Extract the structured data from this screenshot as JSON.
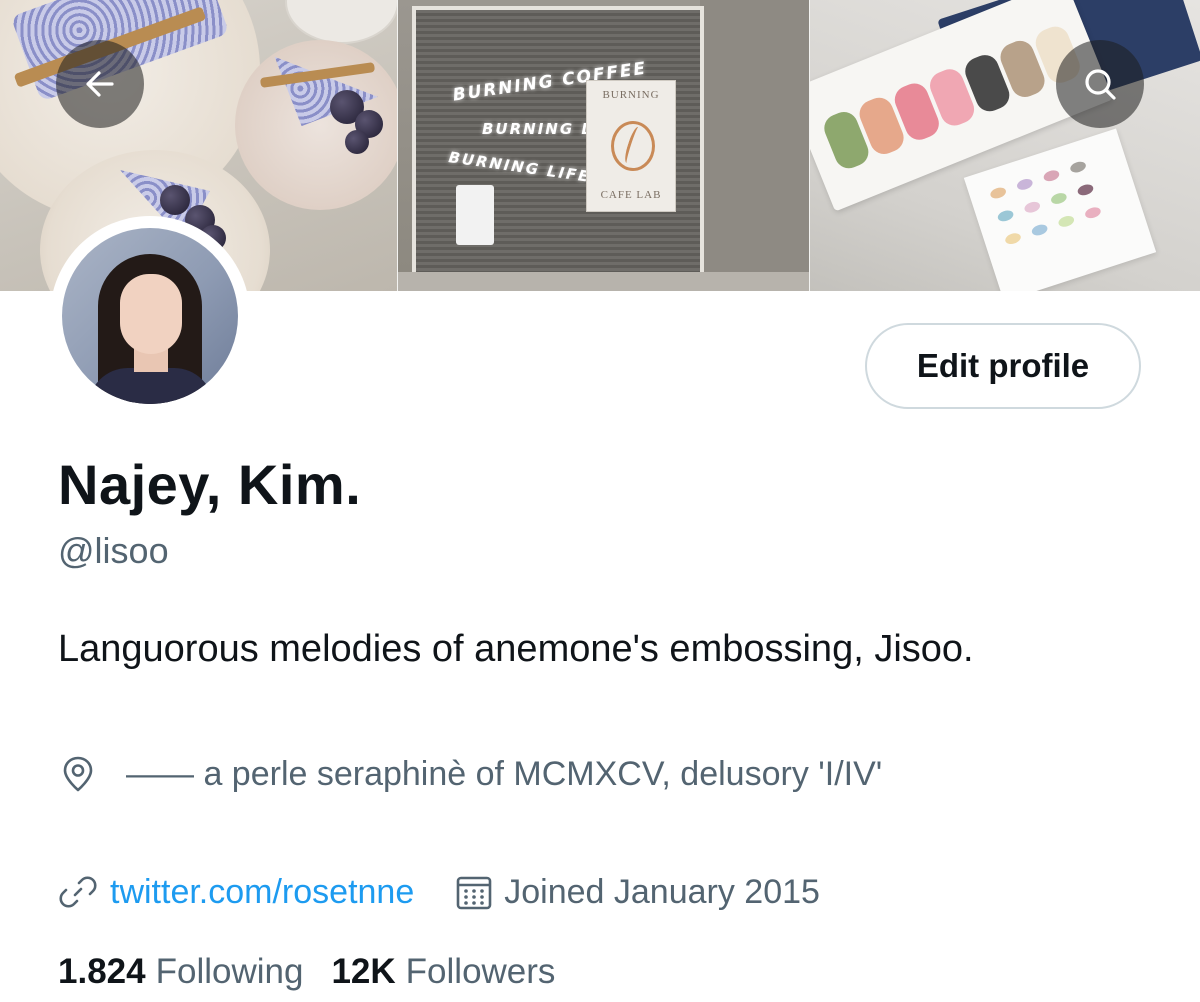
{
  "banner": {
    "neon_line_1": "BURNING COFFEE",
    "neon_line_2": "BURNING LOVE",
    "neon_line_3": "BURNING LIFE",
    "poster_top": "BURNING",
    "poster_bottom": "CAFE LAB"
  },
  "nav": {
    "back_icon": "arrow-left-icon",
    "search_icon": "search-icon"
  },
  "profile": {
    "display_name": "Najey, Kim.",
    "handle": "@lisoo",
    "edit_button_label": "Edit profile",
    "bio": "Languorous melodies of anemone's embossing, Jisoo.",
    "location": "—— a perle seraphinè of MCMXCV, delusory 'I/IV'",
    "website": "twitter.com/rosetnne",
    "joined": "Joined January 2015"
  },
  "stats": {
    "following_count": "1.824",
    "following_label": "Following",
    "followers_count": "12K",
    "followers_label": "Followers"
  },
  "colors": {
    "accent": "#1d9bf0",
    "secondary_text": "#536471",
    "primary_text": "#0f1419",
    "border": "#cfd9de"
  }
}
